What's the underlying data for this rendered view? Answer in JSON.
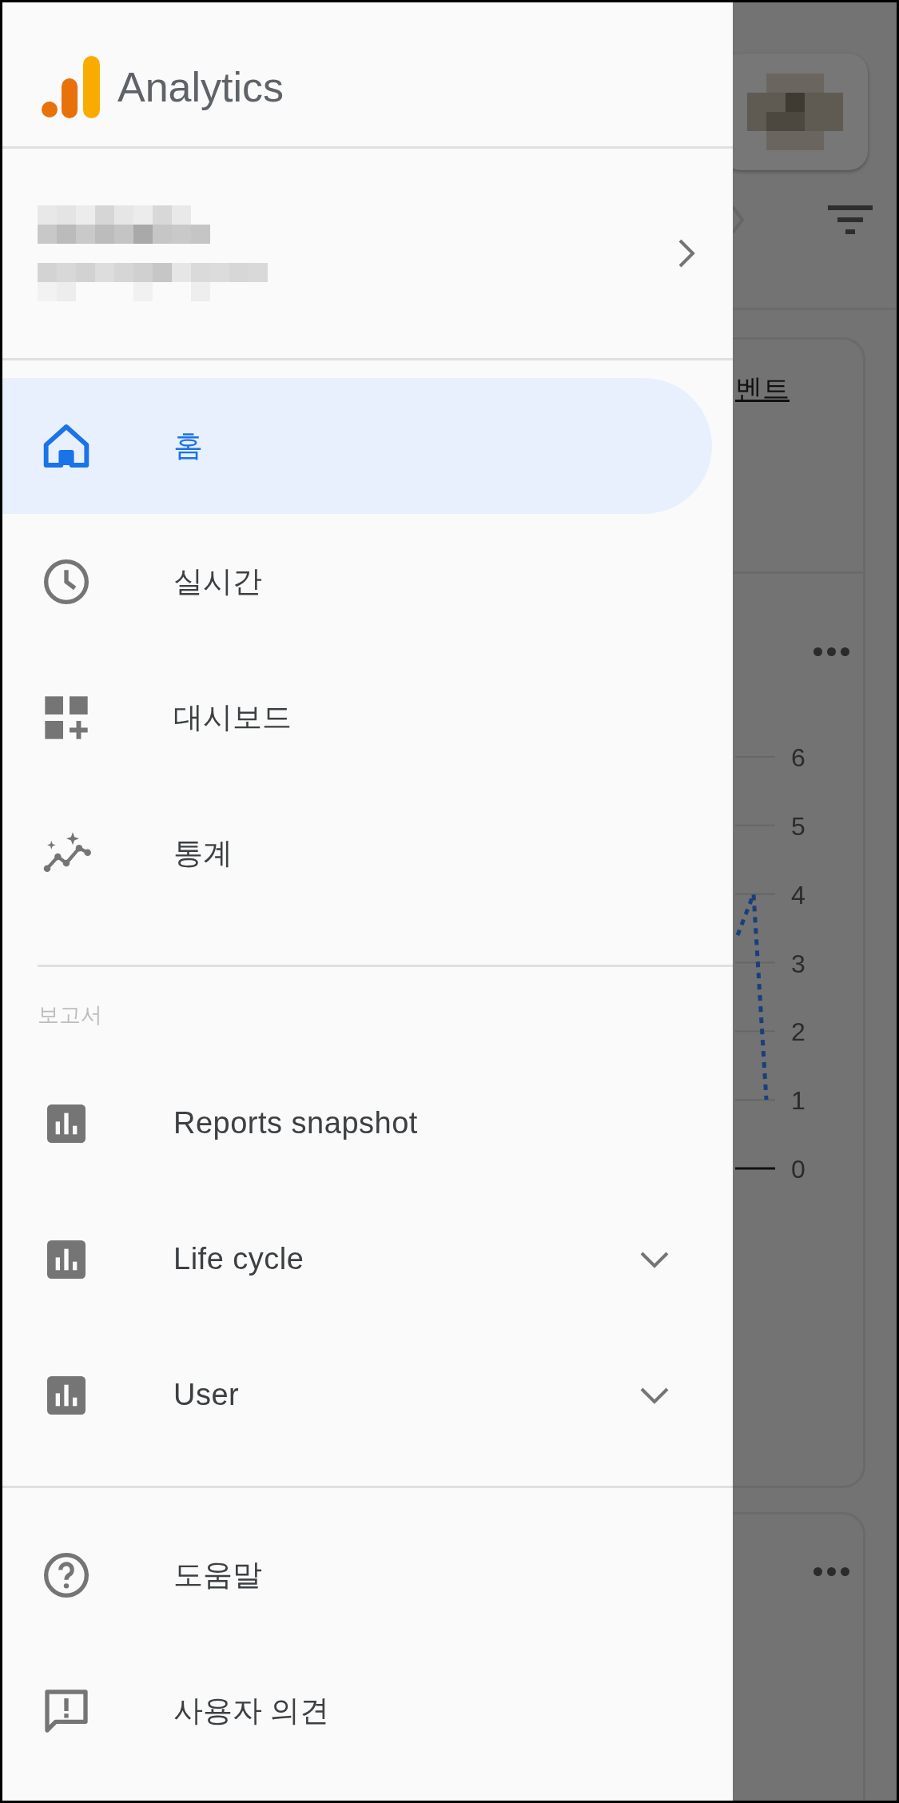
{
  "app": {
    "title": "Analytics"
  },
  "nav": [
    {
      "label": "홈",
      "selected": true
    },
    {
      "label": "실시간",
      "selected": false
    },
    {
      "label": "대시보드",
      "selected": false
    },
    {
      "label": "통계",
      "selected": false
    }
  ],
  "reports": {
    "heading": "보고서",
    "items": [
      {
        "label": "Reports snapshot",
        "kind": "link",
        "selected": false
      },
      {
        "label": "Life cycle",
        "kind": "group",
        "expanded": false,
        "selected": false
      },
      {
        "label": "User",
        "kind": "group",
        "expanded": false,
        "selected": false
      }
    ]
  },
  "footer_items": [
    {
      "label": "도움말"
    },
    {
      "label": "사용자 의견"
    }
  ],
  "background": {
    "card_title": "벤트",
    "axis_labels": [
      "6",
      "5",
      "4",
      "3",
      "2",
      "1",
      "0"
    ]
  }
}
